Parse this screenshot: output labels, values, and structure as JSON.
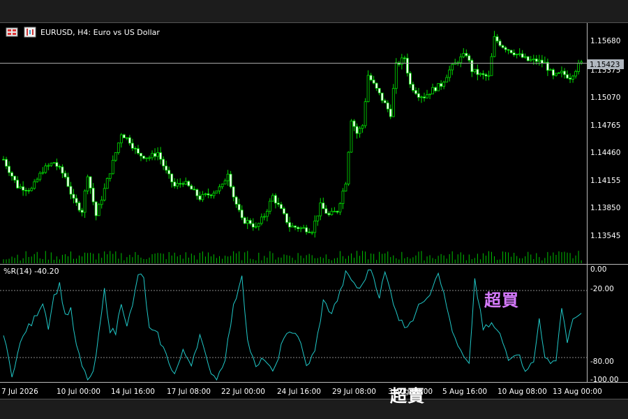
{
  "window": {
    "symbol_title": "EURUSD, H4:  Euro vs US Dollar"
  },
  "price_panel": {
    "current_price": "1.15423",
    "price_ticks": [
      "1.15680",
      "1.15375",
      "1.15070",
      "1.14765",
      "1.14460",
      "1.14155",
      "1.13850",
      "1.13545"
    ]
  },
  "indicator_panel": {
    "title": "%R(14) -40.20",
    "levels": [
      "0.00",
      "-20.00",
      "-80.00",
      "-100.00"
    ],
    "overbought_label": "超買",
    "oversold_label": "超賣"
  },
  "time_axis": {
    "labels": [
      "7 Jul 2026",
      "10 Jul 00:00",
      "14 Jul 16:00",
      "17 Jul 08:00",
      "22 Jul 00:00",
      "24 Jul 16:00",
      "29 Jul 08:00",
      "3 Aug 00:00",
      "5 Aug 16:00",
      "10 Aug 08:00",
      "13 Aug 00:00"
    ]
  },
  "chart_data": [
    {
      "type": "candlestick",
      "symbol": "EURUSD",
      "timeframe": "H4",
      "ylim": [
        1.134,
        1.1578
      ],
      "current_price": 1.15423,
      "anchors": [
        [
          0,
          1.1443
        ],
        [
          5,
          1.1415
        ],
        [
          10,
          1.1412
        ],
        [
          14,
          1.1432
        ],
        [
          18,
          1.144
        ],
        [
          22,
          1.1425
        ],
        [
          25,
          1.14
        ],
        [
          28,
          1.139
        ],
        [
          30,
          1.1428
        ],
        [
          33,
          1.1385
        ],
        [
          36,
          1.1412
        ],
        [
          39,
          1.144
        ],
        [
          42,
          1.147
        ],
        [
          45,
          1.1462
        ],
        [
          48,
          1.1448
        ],
        [
          52,
          1.1445
        ],
        [
          55,
          1.145
        ],
        [
          58,
          1.143
        ],
        [
          61,
          1.1415
        ],
        [
          64,
          1.142
        ],
        [
          67,
          1.1412
        ],
        [
          70,
          1.1403
        ],
        [
          74,
          1.1408
        ],
        [
          78,
          1.1415
        ],
        [
          80,
          1.143
        ],
        [
          82,
          1.1405
        ],
        [
          85,
          1.138
        ],
        [
          88,
          1.1378
        ],
        [
          90,
          1.1372
        ],
        [
          93,
          1.1385
        ],
        [
          96,
          1.1405
        ],
        [
          99,
          1.139
        ],
        [
          102,
          1.1374
        ],
        [
          106,
          1.1372
        ],
        [
          110,
          1.137
        ],
        [
          113,
          1.1395
        ],
        [
          116,
          1.1385
        ],
        [
          119,
          1.139
        ],
        [
          122,
          1.142
        ],
        [
          124,
          1.1485
        ],
        [
          126,
          1.147
        ],
        [
          128,
          1.1478
        ],
        [
          130,
          1.153
        ],
        [
          133,
          1.1515
        ],
        [
          136,
          1.15
        ],
        [
          138,
          1.149
        ],
        [
          140,
          1.154
        ],
        [
          143,
          1.1548
        ],
        [
          145,
          1.152
        ],
        [
          148,
          1.151
        ],
        [
          150,
          1.1508
        ],
        [
          153,
          1.1515
        ],
        [
          156,
          1.152
        ],
        [
          159,
          1.1535
        ],
        [
          162,
          1.1545
        ],
        [
          165,
          1.1552
        ],
        [
          167,
          1.1535
        ],
        [
          170,
          1.153
        ],
        [
          173,
          1.1528
        ],
        [
          175,
          1.1568
        ],
        [
          178,
          1.156
        ],
        [
          181,
          1.1555
        ],
        [
          184,
          1.155
        ],
        [
          187,
          1.1545
        ],
        [
          190,
          1.1545
        ],
        [
          193,
          1.1542
        ],
        [
          196,
          1.1528
        ],
        [
          199,
          1.1532
        ],
        [
          202,
          1.1528
        ],
        [
          205,
          1.154
        ],
        [
          206,
          1.1542
        ]
      ]
    },
    {
      "type": "line",
      "name": "%R(14)",
      "last_value": -40.2,
      "ylim": [
        -100,
        0
      ],
      "levels": [
        -20,
        -80
      ],
      "anchors": [
        [
          0,
          -60
        ],
        [
          3,
          -95
        ],
        [
          6,
          -68
        ],
        [
          8,
          -55
        ],
        [
          10,
          -50
        ],
        [
          12,
          -40
        ],
        [
          14,
          -30
        ],
        [
          16,
          -52
        ],
        [
          18,
          -25
        ],
        [
          20,
          -15
        ],
        [
          22,
          -42
        ],
        [
          24,
          -38
        ],
        [
          26,
          -70
        ],
        [
          28,
          -88
        ],
        [
          30,
          -100
        ],
        [
          32,
          -95
        ],
        [
          34,
          -60
        ],
        [
          36,
          -20
        ],
        [
          38,
          -55
        ],
        [
          40,
          -58
        ],
        [
          42,
          -30
        ],
        [
          44,
          -50
        ],
        [
          46,
          -35
        ],
        [
          48,
          -5
        ],
        [
          50,
          -10
        ],
        [
          52,
          -55
        ],
        [
          55,
          -60
        ],
        [
          58,
          -78
        ],
        [
          61,
          -95
        ],
        [
          64,
          -75
        ],
        [
          67,
          -85
        ],
        [
          70,
          -60
        ],
        [
          73,
          -88
        ],
        [
          76,
          -100
        ],
        [
          79,
          -80
        ],
        [
          82,
          -35
        ],
        [
          85,
          -5
        ],
        [
          87,
          -65
        ],
        [
          90,
          -90
        ],
        [
          93,
          -80
        ],
        [
          96,
          -95
        ],
        [
          99,
          -70
        ],
        [
          102,
          -55
        ],
        [
          105,
          -60
        ],
        [
          108,
          -88
        ],
        [
          111,
          -75
        ],
        [
          114,
          -30
        ],
        [
          117,
          -40
        ],
        [
          120,
          -22
        ],
        [
          122,
          -5
        ],
        [
          124,
          -10
        ],
        [
          127,
          -20
        ],
        [
          129,
          -8
        ],
        [
          131,
          0
        ],
        [
          134,
          -25
        ],
        [
          136,
          -4
        ],
        [
          139,
          -30
        ],
        [
          141,
          -45
        ],
        [
          143,
          -52
        ],
        [
          146,
          -45
        ],
        [
          149,
          -30
        ],
        [
          152,
          -22
        ],
        [
          155,
          -2
        ],
        [
          158,
          -35
        ],
        [
          161,
          -65
        ],
        [
          164,
          -80
        ],
        [
          166,
          -88
        ],
        [
          168,
          -10
        ],
        [
          171,
          -55
        ],
        [
          174,
          -50
        ],
        [
          177,
          -60
        ],
        [
          180,
          -80
        ],
        [
          183,
          -75
        ],
        [
          186,
          -90
        ],
        [
          189,
          -85
        ],
        [
          191,
          -45
        ],
        [
          193,
          -78
        ],
        [
          195,
          -88
        ],
        [
          197,
          -80
        ],
        [
          199,
          -35
        ],
        [
          201,
          -65
        ],
        [
          203,
          -48
        ],
        [
          205,
          -40
        ],
        [
          206,
          -40.2
        ]
      ]
    }
  ]
}
